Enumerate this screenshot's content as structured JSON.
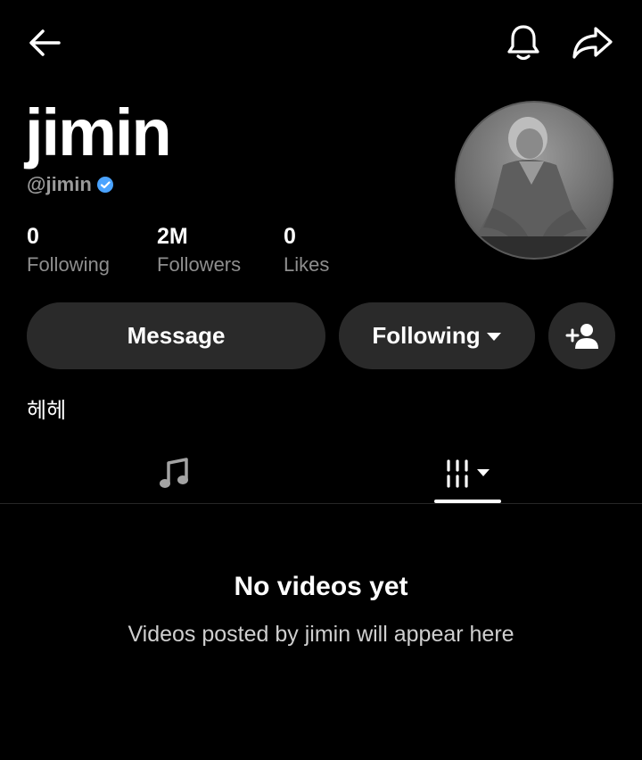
{
  "profile": {
    "display_name": "jimin",
    "handle": "@jimin",
    "verified": true,
    "bio": "헤헤"
  },
  "stats": [
    {
      "value": "0",
      "label": "Following"
    },
    {
      "value": "2M",
      "label": "Followers"
    },
    {
      "value": "0",
      "label": "Likes"
    }
  ],
  "actions": {
    "message_label": "Message",
    "following_label": "Following"
  },
  "tabs": {
    "active": "videos"
  },
  "empty_state": {
    "title": "No videos yet",
    "subtitle": "Videos posted by jimin will appear here"
  },
  "icons": {
    "top_left": "back-arrow-icon",
    "top_right": [
      "bell-icon",
      "share-icon"
    ],
    "verified": "verified-badge-icon",
    "follow_add": "add-user-icon",
    "tab_music": "music-note-icon",
    "tab_videos": "videos-grid-icon"
  },
  "colors": {
    "background": "#000000",
    "button_bg": "#2a2a2a",
    "verified": "#4aa3ff",
    "secondary_text": "#8e8e8e"
  }
}
